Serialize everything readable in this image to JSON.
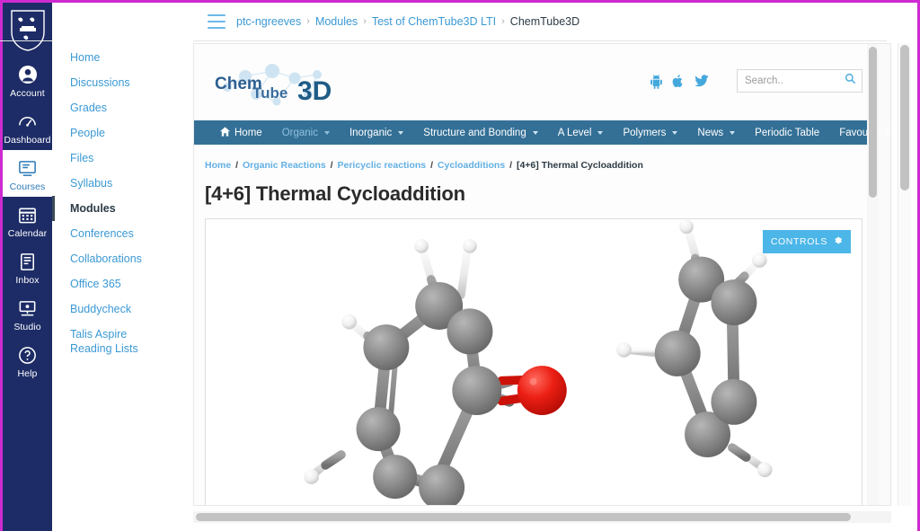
{
  "theme": {
    "global_nav_bg": "#1d2c66",
    "link_blue": "#3b99d4",
    "chem_nav_bg": "#347096",
    "controls_btn_bg": "#4cb6e8",
    "page_border": "#cf2ad1"
  },
  "global_nav": {
    "logo_name": "university-shield-logo",
    "items": [
      {
        "label": "Account",
        "icon": "user-circle-icon",
        "active": false
      },
      {
        "label": "Dashboard",
        "icon": "dashboard-icon",
        "active": false
      },
      {
        "label": "Courses",
        "icon": "courses-icon",
        "active": true
      },
      {
        "label": "Calendar",
        "icon": "calendar-icon",
        "active": false
      },
      {
        "label": "Inbox",
        "icon": "inbox-icon",
        "active": false
      },
      {
        "label": "Studio",
        "icon": "studio-icon",
        "active": false
      },
      {
        "label": "Help",
        "icon": "help-icon",
        "active": false
      }
    ]
  },
  "course_nav": {
    "items": [
      {
        "label": "Home",
        "active": false
      },
      {
        "label": "Discussions",
        "active": false
      },
      {
        "label": "Grades",
        "active": false
      },
      {
        "label": "People",
        "active": false
      },
      {
        "label": "Files",
        "active": false
      },
      {
        "label": "Syllabus",
        "active": false
      },
      {
        "label": "Modules",
        "active": true
      },
      {
        "label": "Conferences",
        "active": false
      },
      {
        "label": "Collaborations",
        "active": false
      },
      {
        "label": "Office 365",
        "active": false
      },
      {
        "label": "Buddycheck",
        "active": false
      },
      {
        "label": "Talis Aspire Reading Lists",
        "active": false
      }
    ]
  },
  "topbar": {
    "menu_icon": "hamburger-icon",
    "breadcrumb": [
      {
        "label": "ptc-ngreeves",
        "current": false
      },
      {
        "label": "Modules",
        "current": false
      },
      {
        "label": "Test of ChemTube3D LTI",
        "current": false
      },
      {
        "label": "ChemTube3D",
        "current": true
      }
    ],
    "separator": "›"
  },
  "chemtube": {
    "logo": {
      "part1": "Chem",
      "part2": "Tube",
      "part3": "3D",
      "name": "chemtube3d-logo"
    },
    "social": [
      {
        "name": "android-icon"
      },
      {
        "name": "apple-icon"
      },
      {
        "name": "twitter-icon"
      }
    ],
    "search": {
      "placeholder": "Search..",
      "value": "",
      "icon": "search-icon"
    },
    "menu": [
      {
        "label": "Home",
        "caret": false,
        "icon": "home-icon",
        "dim": false
      },
      {
        "label": "Organic",
        "caret": true,
        "dim": true
      },
      {
        "label": "Inorganic",
        "caret": true,
        "dim": false
      },
      {
        "label": "Structure and Bonding",
        "caret": true,
        "dim": false
      },
      {
        "label": "A Level",
        "caret": true,
        "dim": false
      },
      {
        "label": "Polymers",
        "caret": true,
        "dim": false
      },
      {
        "label": "News",
        "caret": true,
        "dim": false
      },
      {
        "label": "Periodic Table",
        "caret": false,
        "dim": false
      },
      {
        "label": "Favourite Pages",
        "caret": true,
        "dim": false
      }
    ],
    "breadcrumb": [
      {
        "label": "Home",
        "link": true
      },
      {
        "label": "Organic Reactions",
        "link": true
      },
      {
        "label": "Pericyclic reactions",
        "link": true
      },
      {
        "label": "Cycloadditions",
        "link": true
      },
      {
        "label": "[4+6] Thermal Cycloaddition",
        "link": false
      }
    ],
    "breadcrumb_separator": "/",
    "page_title": "[4+6] Thermal Cycloaddition",
    "viewer": {
      "name": "jsmol-molecule-viewer",
      "controls_label": "CONTROLS",
      "controls_icon": "gear-icon",
      "molecules": "ball-and-stick 3D model: tropone (left) and cyclopentadiene (right)"
    }
  }
}
